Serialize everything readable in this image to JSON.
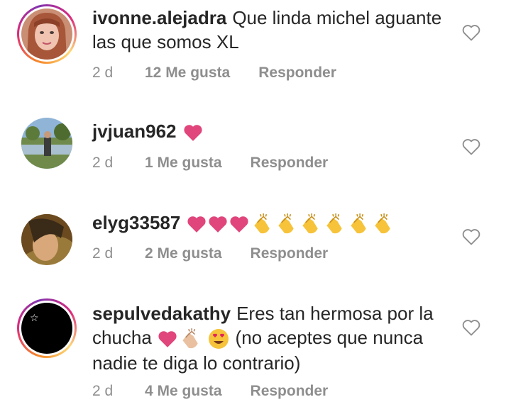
{
  "comments": [
    {
      "username": "ivonne.alejadra",
      "text": "Que linda michel aguante las que somos XL",
      "time": "2 d",
      "likes": "12 Me gusta",
      "reply": "Responder"
    },
    {
      "username": "jvjuan962",
      "text": "",
      "time": "2 d",
      "likes": "1 Me gusta",
      "reply": "Responder"
    },
    {
      "username": "elyg33587",
      "text": "",
      "time": "2 d",
      "likes": "2 Me gusta",
      "reply": "Responder"
    },
    {
      "username": "sepulvedakathy",
      "text_line1": "Eres tan hermosa por la",
      "text_line2a": "chucha",
      "text_line2b": "(no aceptes que nunca",
      "text_line3": "nadie te diga lo contrario)",
      "time": "2 d",
      "likes": "4 Me gusta",
      "reply": "Responder"
    }
  ],
  "icons": {
    "like": "heart-outline-icon",
    "pink_heart": "pink-heart-emoji",
    "clap": "clapping-hands-emoji",
    "heart_eyes": "heart-eyes-emoji"
  },
  "colors": {
    "pink_heart": "#e0457b",
    "clap": "#f6c33a",
    "meta_gray": "#8e8e8e"
  }
}
